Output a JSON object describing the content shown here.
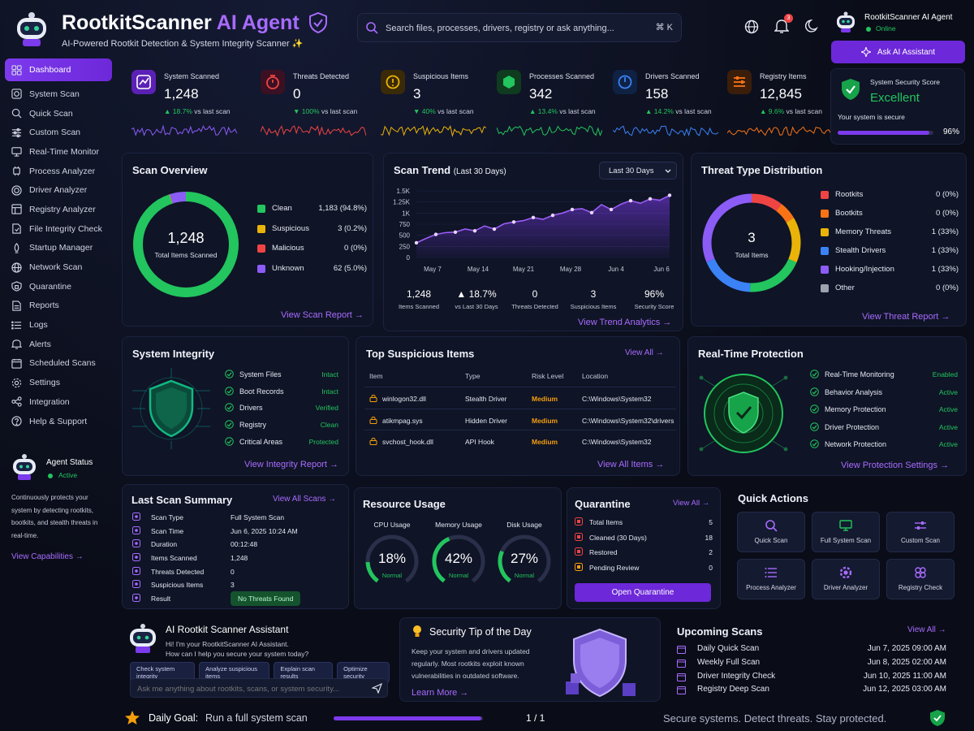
{
  "header": {
    "title": "RootkitScanner",
    "title_accent": "AI Agent",
    "subtitle": "AI-Powered Rootkit Detection & System Integrity Scanner ✨",
    "search_placeholder": "Search files, processes, drivers, registry or ask anything...",
    "search_shortcut": "⌘ K",
    "notification_count": "3",
    "user_name": "RootkitScanner AI Agent",
    "user_status": "Online",
    "ask_ai": "Ask AI Assistant"
  },
  "sidebar": {
    "items": [
      {
        "label": "Dashboard",
        "icon": "dashboard-icon"
      },
      {
        "label": "System Scan",
        "icon": "system-scan-icon"
      },
      {
        "label": "Quick Scan",
        "icon": "search-icon"
      },
      {
        "label": "Custom Scan",
        "icon": "custom-scan-icon"
      },
      {
        "label": "Real-Time Monitor",
        "icon": "monitor-icon"
      },
      {
        "label": "Process Analyzer",
        "icon": "process-icon"
      },
      {
        "label": "Driver Analyzer",
        "icon": "driver-icon"
      },
      {
        "label": "Registry Analyzer",
        "icon": "registry-icon"
      },
      {
        "label": "File Integrity Check",
        "icon": "file-icon"
      },
      {
        "label": "Startup Manager",
        "icon": "startup-icon"
      },
      {
        "label": "Network Scan",
        "icon": "network-icon"
      },
      {
        "label": "Quarantine",
        "icon": "quarantine-icon"
      },
      {
        "label": "Reports",
        "icon": "reports-icon"
      },
      {
        "label": "Logs",
        "icon": "logs-icon"
      },
      {
        "label": "Alerts",
        "icon": "bell-icon"
      },
      {
        "label": "Scheduled Scans",
        "icon": "calendar-icon"
      },
      {
        "label": "Settings",
        "icon": "gear-icon"
      },
      {
        "label": "Integration",
        "icon": "integration-icon"
      },
      {
        "label": "Help & Support",
        "icon": "help-icon"
      }
    ],
    "agent_title": "Agent Status",
    "agent_status": "Active",
    "agent_desc": "Continuously protects your system by detecting rootkits, bootkits, and stealth threats in real-time.",
    "capabilities": "View Capabilities →"
  },
  "stats": [
    {
      "label": "System Scanned",
      "value": "1,248",
      "change": "▲ 18.7%",
      "suffix": " vs last scan",
      "color": "#8b5cf6"
    },
    {
      "label": "Threats Detected",
      "value": "0",
      "change": "▼ 100%",
      "suffix": " vs last scan",
      "color": "#ef4444"
    },
    {
      "label": "Suspicious Items",
      "value": "3",
      "change": "▼ 40%",
      "suffix": " vs last scan",
      "color": "#eab308"
    },
    {
      "label": "Processes Scanned",
      "value": "342",
      "change": "▲ 13.4%",
      "suffix": " vs last scan",
      "color": "#22c55e"
    },
    {
      "label": "Drivers Scanned",
      "value": "158",
      "change": "▲ 14.2%",
      "suffix": " vs last scan",
      "color": "#3b82f6"
    },
    {
      "label": "Registry Items",
      "value": "12,845",
      "change": "▲ 9.6%",
      "suffix": " vs last scan",
      "color": "#f97316"
    }
  ],
  "security_score": {
    "label": "System Security Score",
    "value": "Excellent",
    "note": "Your system is secure",
    "percent": "96%",
    "fraction": 0.96
  },
  "scan_overview": {
    "title": "Scan Overview",
    "total": "1,248",
    "total_label": "Total Items Scanned",
    "items": [
      {
        "label": "Clean",
        "value": "1,183 (94.8%)",
        "color": "#22c55e",
        "frac": 0.948
      },
      {
        "label": "Suspicious",
        "value": "3 (0.2%)",
        "color": "#eab308",
        "frac": 0.002
      },
      {
        "label": "Malicious",
        "value": "0 (0%)",
        "color": "#ef4444",
        "frac": 0
      },
      {
        "label": "Unknown",
        "value": "62 (5.0%)",
        "color": "#8b5cf6",
        "frac": 0.05
      }
    ],
    "link": "View Scan Report →"
  },
  "scan_trend": {
    "title": "Scan Trend",
    "subtitle": "(Last 30 Days)",
    "range": "Last 30 Days",
    "stats": [
      {
        "v": "1,248",
        "l": "Items Scanned"
      },
      {
        "v": "▲ 18.7%",
        "l": "vs Last 30 Days"
      },
      {
        "v": "0",
        "l": "Threats Detected"
      },
      {
        "v": "3",
        "l": "Suspicious Items"
      },
      {
        "v": "96%",
        "l": "Security Score"
      }
    ],
    "link": "View Trend Analytics →"
  },
  "chart_data": {
    "type": "area",
    "yticks": [
      "0",
      "250",
      "500",
      "750",
      "1K",
      "1.25K",
      "1.5K"
    ],
    "ylim": [
      0,
      1500
    ],
    "xticks": [
      "May 7",
      "May 14",
      "May 21",
      "May 28",
      "Jun 4",
      "Jun 6"
    ],
    "values": [
      330,
      430,
      520,
      560,
      570,
      640,
      600,
      710,
      640,
      760,
      800,
      830,
      900,
      860,
      950,
      1000,
      1080,
      1100,
      1010,
      1190,
      1080,
      1200,
      1280,
      1220,
      1320,
      1290,
      1400
    ]
  },
  "threat_dist": {
    "title": "Threat Type Distribution",
    "total": "3",
    "total_label": "Total Items",
    "items": [
      {
        "label": "Rootkits",
        "value": "0 (0%)",
        "color": "#ef4444"
      },
      {
        "label": "Bootkits",
        "value": "0 (0%)",
        "color": "#f97316"
      },
      {
        "label": "Memory Threats",
        "value": "1 (33%)",
        "color": "#eab308"
      },
      {
        "label": "Stealth Drivers",
        "value": "1 (33%)",
        "color": "#3b82f6"
      },
      {
        "label": "Hooking/Injection",
        "value": "1 (33%)",
        "color": "#8b5cf6"
      },
      {
        "label": "Other",
        "value": "0 (0%)",
        "color": "#9ca3af"
      }
    ],
    "link": "View Threat Report →"
  },
  "integrity": {
    "title": "System Integrity",
    "items": [
      {
        "l": "System Files",
        "s": "Intact"
      },
      {
        "l": "Boot Records",
        "s": "Intact"
      },
      {
        "l": "Drivers",
        "s": "Verified"
      },
      {
        "l": "Registry",
        "s": "Clean"
      },
      {
        "l": "Critical Areas",
        "s": "Protected"
      }
    ],
    "link": "View Integrity Report →"
  },
  "suspicious": {
    "title": "Top Suspicious Items",
    "view_all": "View All →",
    "headers": [
      "Item",
      "Type",
      "Risk Level",
      "Location"
    ],
    "rows": [
      [
        "winlogon32.dll",
        "Stealth Driver",
        "Medium",
        "C:\\Windows\\System32"
      ],
      [
        "atikmpag.sys",
        "Hidden Driver",
        "Medium",
        "C:\\Windows\\System32\\drivers"
      ],
      [
        "svchost_hook.dll",
        "API Hook",
        "Medium",
        "C:\\Windows\\System32"
      ]
    ],
    "link": "View All Items →"
  },
  "realtime": {
    "title": "Real-Time Protection",
    "items": [
      {
        "l": "Real-Time Monitoring",
        "s": "Enabled"
      },
      {
        "l": "Behavior Analysis",
        "s": "Active"
      },
      {
        "l": "Memory Protection",
        "s": "Active"
      },
      {
        "l": "Driver Protection",
        "s": "Active"
      },
      {
        "l": "Network Protection",
        "s": "Active"
      }
    ],
    "link": "View Protection Settings →"
  },
  "last_scan": {
    "title": "Last Scan Summary",
    "view_all": "View All Scans →",
    "rows": [
      [
        "Scan Type",
        "Full System Scan"
      ],
      [
        "Scan Time",
        "Jun 6, 2025 10:24 AM"
      ],
      [
        "Duration",
        "00:12:48"
      ],
      [
        "Items Scanned",
        "1,248"
      ],
      [
        "Threats Detected",
        "0"
      ],
      [
        "Suspicious Items",
        "3"
      ],
      [
        "Result",
        "No Threats Found"
      ]
    ]
  },
  "resources": {
    "title": "Resource Usage",
    "gauges": [
      {
        "label": "CPU Usage",
        "value": "18%",
        "status": "Normal",
        "frac": 0.18
      },
      {
        "label": "Memory Usage",
        "value": "42%",
        "status": "Normal",
        "frac": 0.42
      },
      {
        "label": "Disk Usage",
        "value": "27%",
        "status": "Normal",
        "frac": 0.27
      }
    ]
  },
  "quarantine": {
    "title": "Quarantine",
    "view_all": "View All →",
    "rows": [
      [
        "Total Items",
        "5",
        "#ef4444"
      ],
      [
        "Cleaned (30 Days)",
        "18",
        "#ef4444"
      ],
      [
        "Restored",
        "2",
        "#ef4444"
      ],
      [
        "Pending Review",
        "0",
        "#f59e0b"
      ]
    ],
    "button": "Open Quarantine"
  },
  "quick_actions": {
    "title": "Quick Actions",
    "items": [
      "Quick Scan",
      "Full System Scan",
      "Custom Scan",
      "Process Analyzer",
      "Driver Analyzer",
      "Registry Check"
    ]
  },
  "assistant": {
    "title": "AI Rootkit Scanner Assistant",
    "line1": "Hi! I'm your RootkitScanner AI Assistant.",
    "line2": "How can I help you secure your system today?",
    "chips": [
      "Check system integrity",
      "Analyze suspicious items",
      "Explain scan results",
      "Optimize security"
    ],
    "placeholder": "Ask me anything about rootkits, scans, or system security..."
  },
  "tip": {
    "title": "Security Tip of the Day",
    "text": "Keep your system and drivers updated regularly. Most rootkits exploit known vulnerabilities in outdated software.",
    "link": "Learn More →"
  },
  "upcoming": {
    "title": "Upcoming Scans",
    "view_all": "View All →",
    "rows": [
      [
        "Daily Quick Scan",
        "Jun 7, 2025 09:00 AM"
      ],
      [
        "Weekly Full Scan",
        "Jun 8, 2025 02:00 AM"
      ],
      [
        "Driver Integrity Check",
        "Jun 10, 2025 11:00 AM"
      ],
      [
        "Registry Deep Scan",
        "Jun 12, 2025 03:00 AM"
      ]
    ]
  },
  "footer": {
    "goal_label": "Daily Goal:",
    "goal_text": "Run a full system scan",
    "goal_count": "1 / 1",
    "goal_frac": 1,
    "tagline": "Secure systems. Detect threats. Stay protected."
  }
}
